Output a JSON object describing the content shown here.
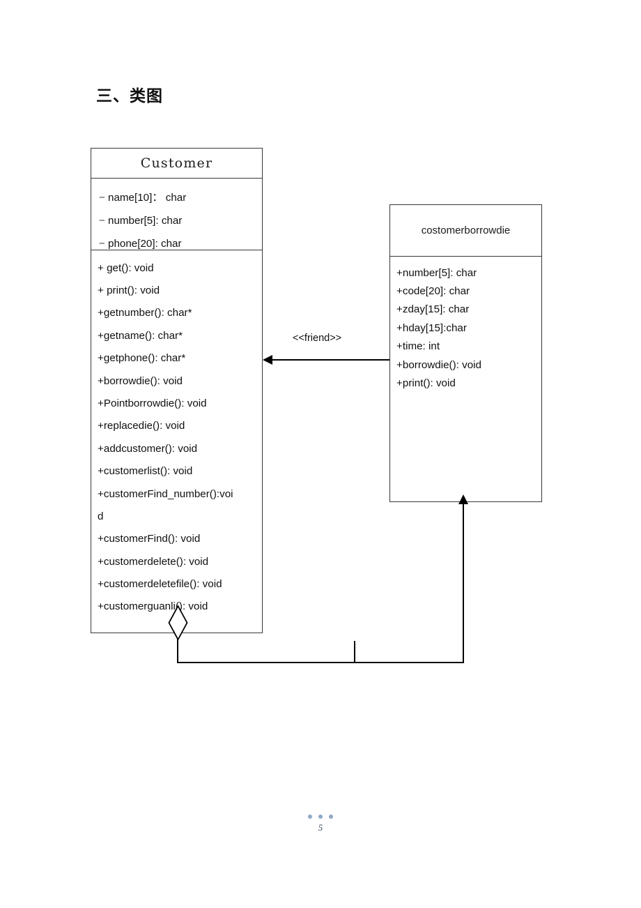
{
  "page": {
    "heading": "三、类图",
    "page_number": "5",
    "footer_dot_color": "#8fa8c8"
  },
  "diagram": {
    "type": "uml-class-diagram",
    "classes": [
      {
        "id": "customer",
        "name": "Customer",
        "attributes": [
          {
            "visibility": "−",
            "text": "name[10]： char"
          },
          {
            "visibility": "−",
            "text": "number[5]:   char"
          },
          {
            "visibility": "−",
            "text": "phone[20]: char"
          }
        ],
        "methods": [
          {
            "text": "+ get(): void"
          },
          {
            "text": "+ print(): void"
          },
          {
            "text": "+getnumber(): char*"
          },
          {
            "text": "+getname(): char*"
          },
          {
            "text": "+getphone(): char*"
          },
          {
            "text": "+borrowdie(): void"
          },
          {
            "text": "+Pointborrowdie(): void"
          },
          {
            "text": "+replacedie(): void"
          },
          {
            "text": "+addcustomer(): void"
          },
          {
            "text": "+customerlist(): void"
          },
          {
            "text": "+customerFind_number():voi"
          },
          {
            "text": "d"
          },
          {
            "text": "+customerFind(): void"
          },
          {
            "text": "+customerdelete(): void"
          },
          {
            "text": "+customerdeletefile(): void"
          },
          {
            "text": "+customerguanli(): void"
          }
        ]
      },
      {
        "id": "costomerborrowdie",
        "name": "costomerborrowdie",
        "members": [
          {
            "text": "+number[5]: char"
          },
          {
            "text": "+code[20]: char"
          },
          {
            "text": "+zday[15]: char"
          },
          {
            "text": "+hday[15]:char"
          },
          {
            "text": "+time: int"
          },
          {
            "text": "+borrowdie(): void"
          },
          {
            "text": "+print(): void"
          }
        ]
      }
    ],
    "relationships": [
      {
        "id": "friend-dependency",
        "label": "<<friend>>",
        "from": "costomerborrowdie",
        "to": "customer",
        "arrow": "filled-arrow-left"
      },
      {
        "id": "aggregation",
        "label": "",
        "from": "customer",
        "to": "costomerborrowdie",
        "arrow": "hollow-diamond-and-filled-arrow-up"
      }
    ]
  }
}
